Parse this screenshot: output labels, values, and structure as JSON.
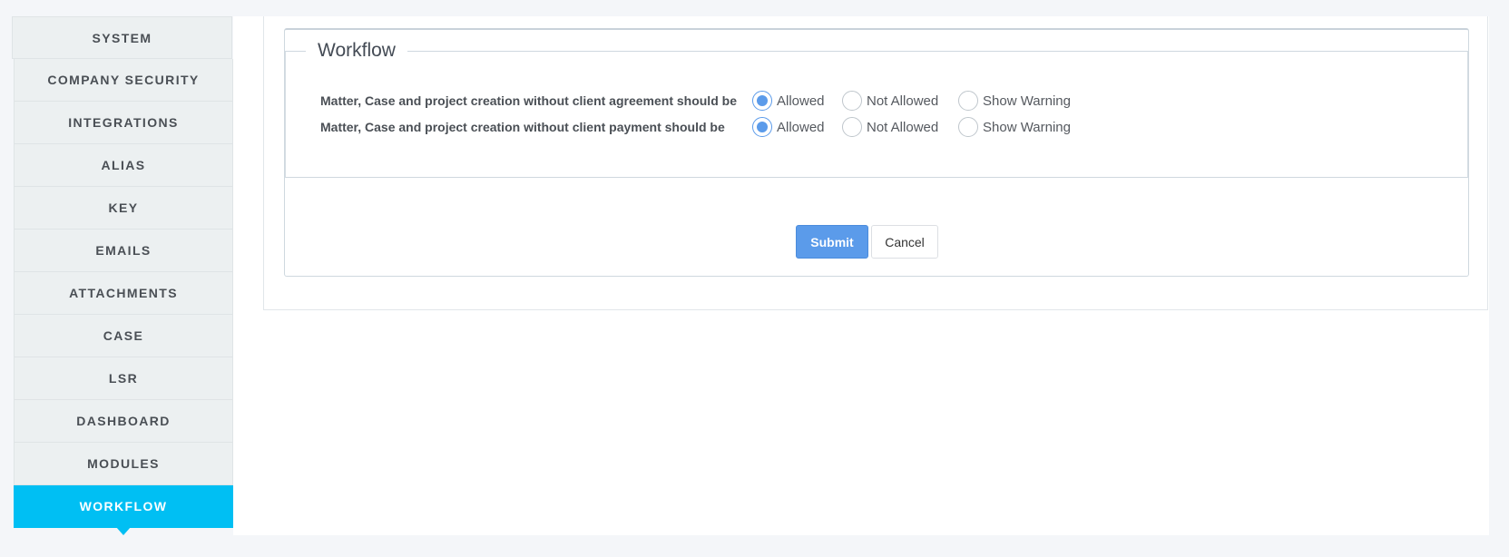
{
  "sidebar": {
    "items": [
      {
        "label": "SYSTEM"
      },
      {
        "label": "COMPANY SECURITY"
      },
      {
        "label": "INTEGRATIONS"
      },
      {
        "label": "ALIAS"
      },
      {
        "label": "KEY"
      },
      {
        "label": "EMAILS"
      },
      {
        "label": "ATTACHMENTS"
      },
      {
        "label": "CASE"
      },
      {
        "label": "LSR"
      },
      {
        "label": "DASHBOARD"
      },
      {
        "label": "MODULES"
      },
      {
        "label": "WORKFLOW",
        "active": true
      }
    ]
  },
  "main": {
    "section_title": "Workflow",
    "settings": [
      {
        "label": "Matter, Case and project creation without client agreement should be",
        "options": [
          "Allowed",
          "Not Allowed",
          "Show Warning"
        ],
        "selected": "Allowed"
      },
      {
        "label": "Matter, Case and project creation without client payment should be",
        "options": [
          "Allowed",
          "Not Allowed",
          "Show Warning"
        ],
        "selected": "Allowed"
      }
    ],
    "submit_label": "Submit",
    "cancel_label": "Cancel"
  },
  "colors": {
    "active_nav": "#00bff3",
    "primary_button": "#5b9bea",
    "radio_checked": "#5b9bea"
  }
}
